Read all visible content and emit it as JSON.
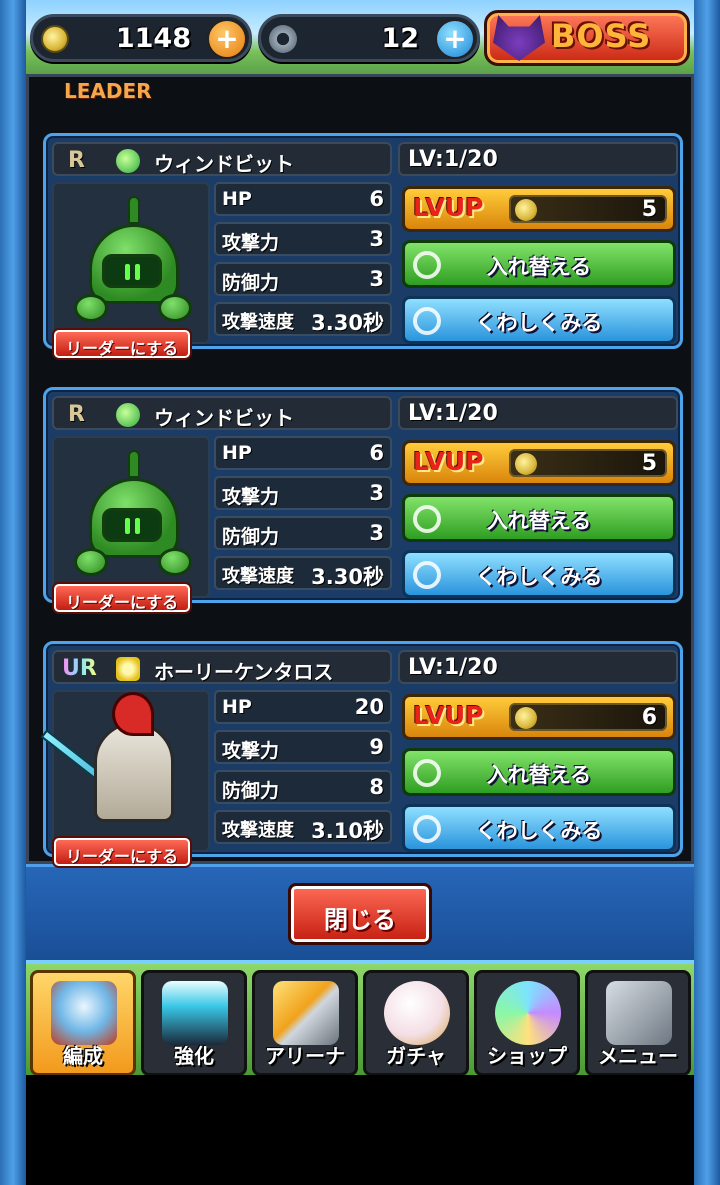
{
  "topbar": {
    "coins": "1148",
    "gears": "12",
    "boss_label": "BOSS"
  },
  "panel": {
    "leader_header": "LEADER"
  },
  "cards": [
    {
      "rarity": "R",
      "element_icon": "wind-element-icon",
      "name": "ウィンドビット",
      "level": "LV:1/20",
      "stats": [
        {
          "label": "HP",
          "value": "6"
        },
        {
          "label": "攻撃力",
          "value": "3"
        },
        {
          "label": "防御力",
          "value": "3"
        },
        {
          "label": "攻撃速度",
          "value": "3.30秒"
        }
      ],
      "lvup_label": "LVUP",
      "lvup_cost": "5",
      "swap_label": "入れ替える",
      "detail_label": "くわしくみる",
      "leader_label": "リーダーにする"
    },
    {
      "rarity": "R",
      "element_icon": "wind-element-icon",
      "name": "ウィンドビット",
      "level": "LV:1/20",
      "stats": [
        {
          "label": "HP",
          "value": "6"
        },
        {
          "label": "攻撃力",
          "value": "3"
        },
        {
          "label": "防御力",
          "value": "3"
        },
        {
          "label": "攻撃速度",
          "value": "3.30秒"
        }
      ],
      "lvup_label": "LVUP",
      "lvup_cost": "5",
      "swap_label": "入れ替える",
      "detail_label": "くわしくみる",
      "leader_label": "リーダーにする"
    },
    {
      "rarity": "UR",
      "element_icon": "holy-element-icon",
      "name": "ホーリーケンタロス",
      "level": "LV:1/20",
      "stats": [
        {
          "label": "HP",
          "value": "20"
        },
        {
          "label": "攻撃力",
          "value": "9"
        },
        {
          "label": "防御力",
          "value": "8"
        },
        {
          "label": "攻撃速度",
          "value": "3.10秒"
        }
      ],
      "lvup_label": "LVUP",
      "lvup_cost": "6",
      "swap_label": "入れ替える",
      "detail_label": "くわしくみる",
      "leader_label": "リーダーにする"
    }
  ],
  "close_label": "閉じる",
  "tabs": [
    {
      "label": "編成",
      "active": true
    },
    {
      "label": "強化",
      "active": false
    },
    {
      "label": "アリーナ",
      "active": false
    },
    {
      "label": "ガチャ",
      "active": false
    },
    {
      "label": "ショップ",
      "active": false
    },
    {
      "label": "メニュー",
      "active": false
    }
  ]
}
